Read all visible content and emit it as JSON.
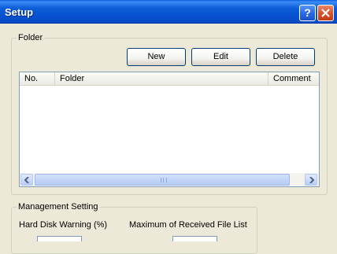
{
  "window": {
    "title": "Setup",
    "help_label": "?"
  },
  "folder_group": {
    "label": "Folder",
    "buttons": {
      "new": "New",
      "edit": "Edit",
      "delete": "Delete"
    },
    "list": {
      "columns": [
        "No.",
        "Folder",
        "Comment"
      ],
      "rows": []
    }
  },
  "management_group": {
    "label": "Management Setting",
    "hdd_warning_label": "Hard Disk Warning (%)",
    "max_received_label": "Maximum of Received File List"
  }
}
